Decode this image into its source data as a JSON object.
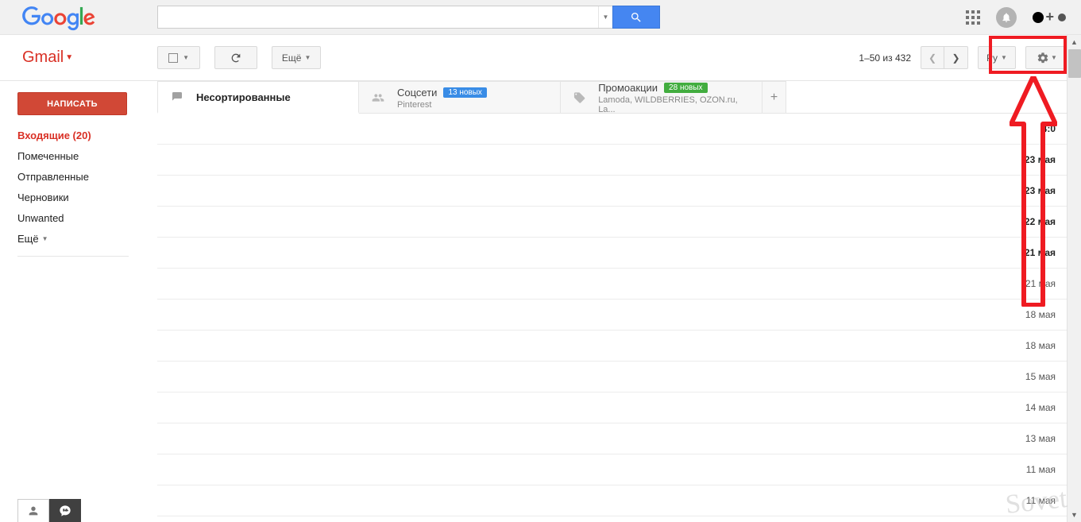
{
  "brand": {
    "gmail_label": "Gmail"
  },
  "search": {
    "placeholder": ""
  },
  "toolbar": {
    "more_label": "Ещё",
    "pager_text": "1–50 из 432",
    "lang_label": "Ру"
  },
  "sidebar": {
    "compose": "НАПИСАТЬ",
    "items": [
      {
        "label": "Входящие (20)",
        "active": true
      },
      {
        "label": "Помеченные"
      },
      {
        "label": "Отправленные"
      },
      {
        "label": "Черновики"
      },
      {
        "label": "Unwanted"
      }
    ],
    "more": "Ещё"
  },
  "tabs": {
    "primary": "Несортированные",
    "social": {
      "label": "Соцсети",
      "badge": "13 новых",
      "sub": "Pinterest"
    },
    "promotions": {
      "label": "Промоакции",
      "badge": "28 новых",
      "sub": "Lamoda, WILDBERRIES, OZON.ru, La..."
    }
  },
  "messages": [
    {
      "date": "4:0",
      "unread": true
    },
    {
      "date": "23 мая",
      "unread": true
    },
    {
      "date": "23 мая",
      "unread": true
    },
    {
      "date": "22 мая",
      "unread": true
    },
    {
      "date": "21 мая",
      "unread": true
    },
    {
      "date": "21 мая"
    },
    {
      "date": "18 мая"
    },
    {
      "date": "18 мая"
    },
    {
      "date": "15 мая"
    },
    {
      "date": "14 мая"
    },
    {
      "date": "13 мая"
    },
    {
      "date": "11 мая"
    },
    {
      "date": "11 мая"
    }
  ],
  "watermark": "Sovet"
}
